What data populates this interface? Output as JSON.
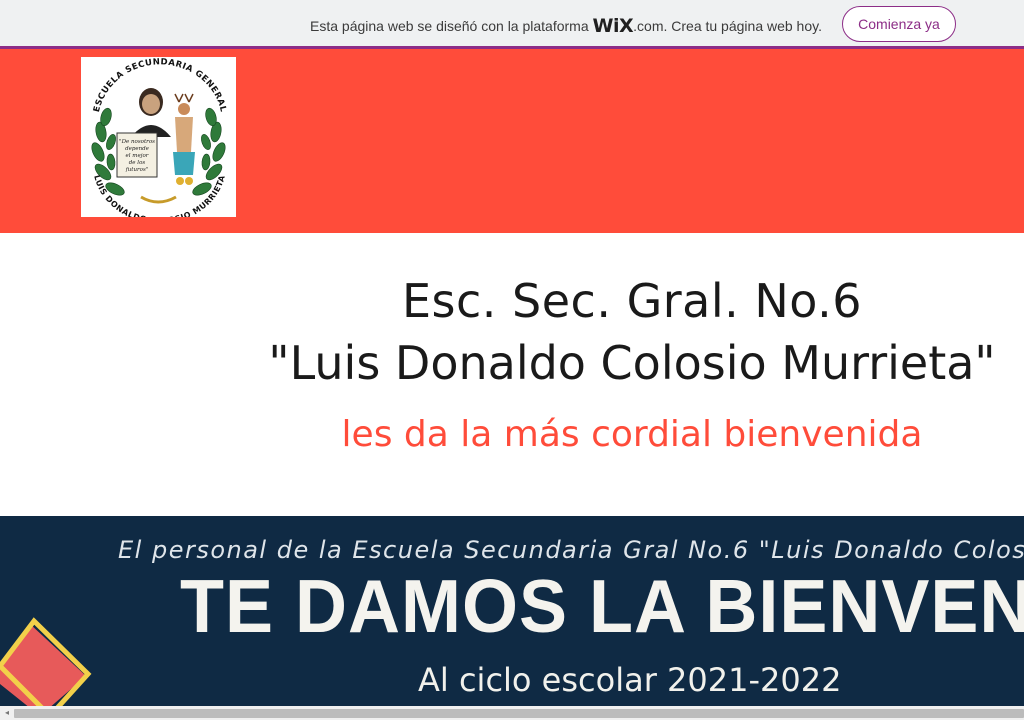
{
  "wix_banner": {
    "text_before": "Esta página web se diseñó con la plataforma ",
    "logo": "WiX",
    "text_after": ".com. Crea tu página web hoy.",
    "button_label": "Comienza ya",
    "accent_color": "#8c2d87"
  },
  "header": {
    "background_color": "#ff4c3a",
    "logo": {
      "top_text": "ESCUELA SECUNDARIA GENERAL",
      "bottom_text": "LUIS DONALDO COLOSIO MURRIETA",
      "scroll_text": [
        "\"De nosotros",
        "depende",
        "el mejor",
        "de los",
        "futuros\""
      ]
    }
  },
  "welcome": {
    "title_line1": "Esc. Sec. Gral. No.6",
    "title_line2": "\"Luis Donaldo Colosio Murrieta\"",
    "subtitle": "les da la más cordial bienvenida",
    "subtitle_color": "#ff4c3a"
  },
  "banner": {
    "line1": "El personal de la Escuela Secundaria Gral No.6 \"Luis Donaldo Colosio Mu",
    "line2": "TE DAMOS LA BIENVENIDA",
    "line3": "Al ciclo escolar 2021-2022",
    "background_color": "#0f2a44"
  },
  "scrollbar": {
    "left_arrow_icon": "chevron-left-icon"
  }
}
